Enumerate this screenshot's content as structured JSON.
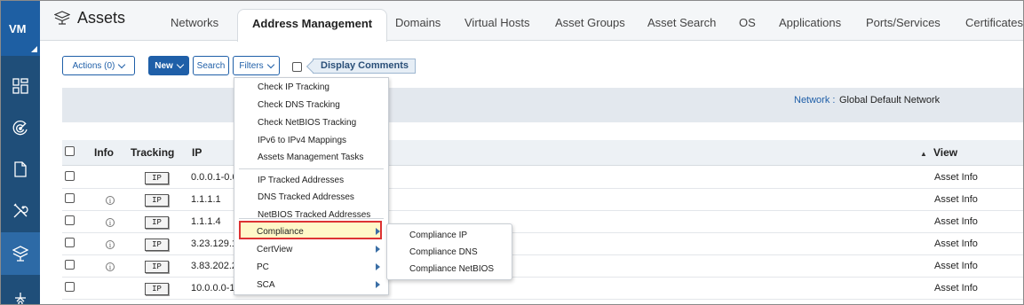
{
  "rail": {
    "logo": "VM",
    "items": [
      {
        "name": "dashboard-icon"
      },
      {
        "name": "scan-radar-icon"
      },
      {
        "name": "document-icon"
      },
      {
        "name": "tools-icon"
      },
      {
        "name": "assets-icon",
        "active": true
      },
      {
        "name": "network-node-icon"
      }
    ]
  },
  "header": {
    "title": "Assets",
    "tabs": [
      {
        "label": "Networks"
      },
      {
        "label": "Address Management",
        "active": true
      },
      {
        "label": "Domains"
      },
      {
        "label": "Virtual Hosts"
      },
      {
        "label": "Asset Groups"
      },
      {
        "label": "Asset Search"
      },
      {
        "label": "OS"
      },
      {
        "label": "Applications"
      },
      {
        "label": "Ports/Services"
      },
      {
        "label": "Certificates"
      }
    ]
  },
  "toolbar": {
    "actions_label": "Actions (0)",
    "new_label": "New",
    "search_label": "Search",
    "filters_label": "Filters",
    "display_comments_label": "Display Comments"
  },
  "network": {
    "label": "Network",
    "separator": ":",
    "value": "Global Default Network"
  },
  "table": {
    "headers": {
      "info": "Info",
      "tracking": "Tracking",
      "ip": "IP",
      "view": "View"
    },
    "sort_glyph": "▲",
    "tracking_badge": "IP",
    "view_text": "Asset Info",
    "rows": [
      {
        "ip": "0.0.0.1-0.0",
        "info": false
      },
      {
        "ip": "1.1.1.1",
        "info": true
      },
      {
        "ip": "1.1.1.4",
        "info": true
      },
      {
        "ip": "3.23.129.1",
        "info": true
      },
      {
        "ip": "3.83.202.2",
        "info": true
      },
      {
        "ip": "10.0.0.0-1",
        "info": false
      }
    ]
  },
  "filters_menu": {
    "group1": [
      "Check IP Tracking",
      "Check DNS Tracking",
      "Check NetBIOS Tracking",
      "IPv6 to IPv4 Mappings",
      "Assets Management Tasks"
    ],
    "group2": [
      "IP Tracked Addresses",
      "DNS Tracked Addresses",
      "NetBIOS Tracked Addresses"
    ],
    "group3": [
      {
        "label": "Compliance",
        "highlighted": true
      },
      {
        "label": "CertView"
      },
      {
        "label": "PC"
      },
      {
        "label": "SCA"
      }
    ]
  },
  "compliance_submenu": [
    "Compliance IP",
    "Compliance DNS",
    "Compliance NetBIOS"
  ],
  "colors": {
    "rail": "#1f4e79",
    "rail_active": "#2d6aa6",
    "primary": "#1f5fa8",
    "highlight_fill": "#fff8c8",
    "highlight_border": "#dd3333"
  }
}
